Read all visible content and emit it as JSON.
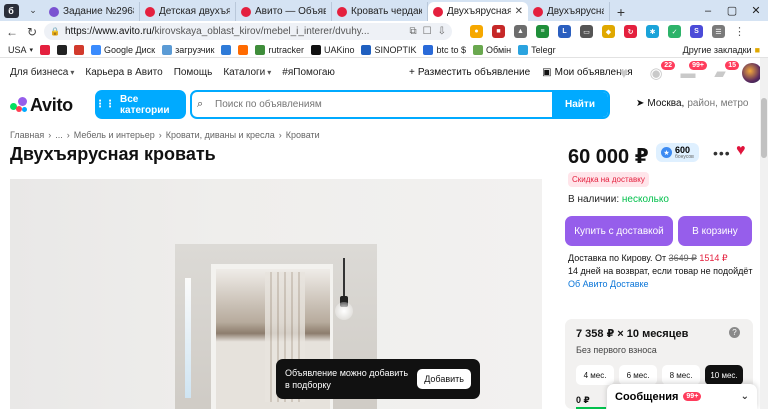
{
  "browser": {
    "tabs": [
      {
        "title": "",
        "color": "#2b2f3a",
        "active": false
      },
      {
        "title": "Задание №2968915",
        "color": "#7a52d1",
        "active": false
      },
      {
        "title": "Детская двухъярусная",
        "color": "#e4203e",
        "active": false
      },
      {
        "title": "Авито — Объявления",
        "color": "#e4203e",
        "active": false
      },
      {
        "title": "Кровать чердак домик",
        "color": "#e4203e",
        "active": false
      },
      {
        "title": "Двухъярусная кровать",
        "color": "#e4203e",
        "active": true
      },
      {
        "title": "Двухъярусная Эко кровать",
        "color": "#e4203e",
        "active": false
      }
    ],
    "url_host": "https://www.avito.ru/",
    "url_path": "kirovskaya_oblast_kirov/mebel_i_interer/dvuhy...",
    "bookmarks": [
      "USA",
      "Google Диск",
      "загрузчик",
      "rutracker",
      "UAKino",
      "SINOPTIK",
      "btc to $",
      "Обмін",
      "Telegr"
    ],
    "bookmarks_other": "Другие закладки"
  },
  "avito": {
    "top_links": [
      "Для бизнеса",
      "Карьера в Авито",
      "Помощь",
      "Каталоги",
      "#яПомогаю"
    ],
    "post_ad": "Разместить объявление",
    "my_ads": "Мои объявления",
    "badges": {
      "notifications": "22",
      "messages": "99+",
      "cart": "15"
    },
    "logo_text": "Avito",
    "all_categories": "Все категории",
    "search_placeholder": "Поиск по объявлениям",
    "search_button": "Найти",
    "location_city": "Москва,",
    "location_rest": "район, метро",
    "breadcrumbs": [
      "Главная",
      "...",
      "Мебель и интерьер",
      "Кровати, диваны и кресла",
      "Кровати"
    ],
    "title": "Двухъярусная кровать",
    "price": "60 000 ₽",
    "bonus_value": "600",
    "bonus_label": "бонусов",
    "discount_badge": "Скидка на доставку",
    "stock_label": "В наличии:",
    "stock_value": "несколько",
    "buy_button": "Купить с доставкой",
    "cart_button": "В корзину",
    "delivery_prefix": "Доставка по Кирову. От",
    "delivery_old": "3649 ₽",
    "delivery_new": "1514 ₽",
    "return_text": "14 дней на возврат, если товар не подойдёт",
    "delivery_link": "Об Авито Доставке",
    "credit": {
      "amount": "7 358 ₽ × 10 месяцев",
      "subtitle": "Без первого взноса",
      "months": [
        "4 мес.",
        "6 мес.",
        "8 мес.",
        "10 мес."
      ],
      "selected": "10 мес.",
      "zero": "0 ₽"
    },
    "toast": {
      "message": "Объявление можно добавить в подборку",
      "button": "Добавить"
    },
    "messages_label": "Сообщения",
    "messages_count": "99+"
  }
}
